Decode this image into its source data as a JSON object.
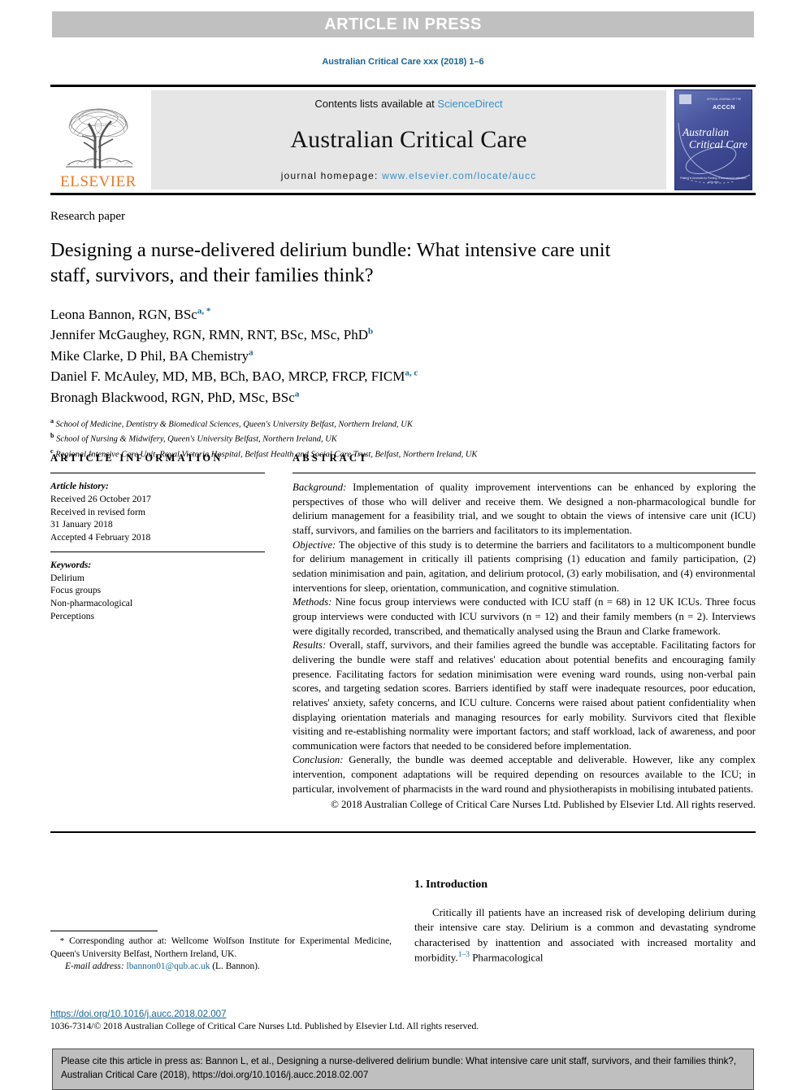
{
  "banner": {
    "label": "ARTICLE IN PRESS"
  },
  "running_head": "Australian Critical Care xxx (2018) 1–6",
  "masthead": {
    "publisher_name": "ELSEVIER",
    "contents_prefix": "Contents lists available at ",
    "contents_link": "ScienceDirect",
    "journal_name": "Australian Critical Care",
    "homepage_prefix": "journal homepage: ",
    "homepage_link": "www.elsevier.com/locate/aucc",
    "cover": {
      "association_line": "OFFICIAL JOURNAL OF THE",
      "association_acronym": "ACCCN",
      "association_sub": "AUSTRALIAN COLLEGE OF CRITICAL CARE NURSES",
      "title_line1": "Australian",
      "title_line2": "Critical Care",
      "footer_line": "Printed in Australia by Printing, it and around\nactivities, all is free"
    }
  },
  "article": {
    "type": "Research paper",
    "title": "Designing a nurse-delivered delirium bundle: What intensive care unit staff, survivors, and their families think?",
    "authors": [
      {
        "name": "Leona Bannon, RGN, BSc",
        "marks": "a, *"
      },
      {
        "name": "Jennifer McGaughey, RGN, RMN, RNT, BSc, MSc, PhD",
        "marks": "b"
      },
      {
        "name": "Mike Clarke, D Phil, BA Chemistry",
        "marks": "a"
      },
      {
        "name": "Daniel F. McAuley, MD, MB, BCh, BAO, MRCP, FRCP, FICM",
        "marks": "a, c"
      },
      {
        "name": "Bronagh Blackwood, RGN, PhD, MSc, BSc",
        "marks": "a"
      }
    ],
    "affiliations": [
      {
        "mark": "a",
        "text": "School of Medicine, Dentistry & Biomedical Sciences, Queen's University Belfast, Northern Ireland, UK"
      },
      {
        "mark": "b",
        "text": "School of Nursing & Midwifery, Queen's University Belfast, Northern Ireland, UK"
      },
      {
        "mark": "c",
        "text": "Regional Intensive Care Unit, Royal Victoria Hospital, Belfast Health and Social Care Trust, Belfast, Northern Ireland, UK"
      }
    ]
  },
  "article_information": {
    "heading": "ARTICLE INFORMATION",
    "history_label": "Article history:",
    "history_lines": [
      "Received 26 October 2017",
      "Received in revised form",
      "31 January 2018",
      "Accepted 4 February 2018"
    ],
    "keywords_label": "Keywords:",
    "keywords": [
      "Delirium",
      "Focus groups",
      "Non-pharmacological",
      "Perceptions"
    ]
  },
  "abstract": {
    "heading": "ABSTRACT",
    "background_label": "Background:",
    "background_text": " Implementation of quality improvement interventions can be enhanced by exploring the perspectives of those who will deliver and receive them. We designed a non-pharmacological bundle for delirium management for a feasibility trial, and we sought to obtain the views of intensive care unit (ICU) staff, survivors, and families on the barriers and facilitators to its implementation.",
    "objective_label": "Objective:",
    "objective_text": " The objective of this study is to determine the barriers and facilitators to a multicomponent bundle for delirium management in critically ill patients comprising (1) education and family participation, (2) sedation minimisation and pain, agitation, and delirium protocol, (3) early mobilisation, and (4) environmental interventions for sleep, orientation, communication, and cognitive stimulation.",
    "methods_label": "Methods:",
    "methods_text": " Nine focus group interviews were conducted with ICU staff (n = 68) in 12 UK ICUs. Three focus group interviews were conducted with ICU survivors (n = 12) and their family members (n = 2). Interviews were digitally recorded, transcribed, and thematically analysed using the Braun and Clarke framework.",
    "results_label": "Results:",
    "results_text": " Overall, staff, survivors, and their families agreed the bundle was acceptable. Facilitating factors for delivering the bundle were staff and relatives' education about potential benefits and encouraging family presence. Facilitating factors for sedation minimisation were evening ward rounds, using non-verbal pain scores, and targeting sedation scores. Barriers identified by staff were inadequate resources, poor education, relatives' anxiety, safety concerns, and ICU culture. Concerns were raised about patient confidentiality when displaying orientation materials and managing resources for early mobility. Survivors cited that flexible visiting and re-establishing normality were important factors; and staff workload, lack of awareness, and poor communication were factors that needed to be considered before implementation.",
    "conclusion_label": "Conclusion:",
    "conclusion_text": " Generally, the bundle was deemed acceptable and deliverable. However, like any complex intervention, component adaptations will be required depending on resources available to the ICU; in particular, involvement of pharmacists in the ward round and physiotherapists in mobilising intubated patients.",
    "copyright": "© 2018 Australian College of Critical Care Nurses Ltd. Published by Elsevier Ltd. All rights reserved."
  },
  "introduction": {
    "heading": "1. Introduction",
    "paragraph_before_ref": "Critically ill patients have an increased risk of developing delirium during their intensive care stay. Delirium is a common and devastating syndrome characterised by inattention and associated with increased mortality and morbidity.",
    "reference_marker": "1–3",
    "paragraph_after_ref": " Pharmacological"
  },
  "footnote": {
    "corresponding_marker": "*",
    "corresponding_text": " Corresponding author at: Wellcome Wolfson Institute for Experimental Medicine, Queen's University Belfast, Northern Ireland, UK.",
    "email_label": "E-mail address:",
    "email_link": "lbannon01@qub.ac.uk",
    "email_suffix": " (L. Bannon)."
  },
  "publication_footer": {
    "doi_url": "https://doi.org/10.1016/j.aucc.2018.02.007",
    "issn_line": "1036-7314/© 2018 Australian College of Critical Care Nurses Ltd. Published by Elsevier Ltd. All rights reserved."
  },
  "cite_box": {
    "text": "Please cite this article in press as: Bannon L, et al., Designing a nurse-delivered delirium bundle: What intensive care unit staff, survivors, and their families think?, Australian Critical Care (2018), https://doi.org/10.1016/j.aucc.2018.02.007"
  },
  "colors": {
    "link_blue": "#1a6496",
    "masthead_link_blue": "#3a8fc4",
    "elsevier_orange": "#e87722",
    "banner_gray": "#c0c0c0",
    "masthead_gray": "#e6e6e6",
    "cite_gray": "#bfbfbf"
  }
}
